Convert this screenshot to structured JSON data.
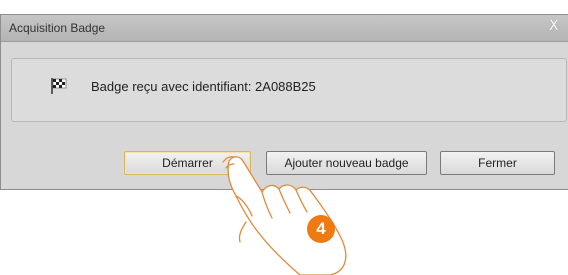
{
  "window": {
    "title": "Acquisition Badge",
    "close_glyph": "X"
  },
  "message": {
    "icon": "checkered-flag-icon",
    "text": "Badge reçu avec identifiant: 2A088B25"
  },
  "buttons": {
    "start_label": "Démarrer",
    "add_label": "Ajouter nouveau badge",
    "close_label": "Fermer"
  },
  "annotation": {
    "step_number": "4"
  },
  "colors": {
    "step_badge": "#ee7a12",
    "hand_outline": "#e08a3c"
  }
}
